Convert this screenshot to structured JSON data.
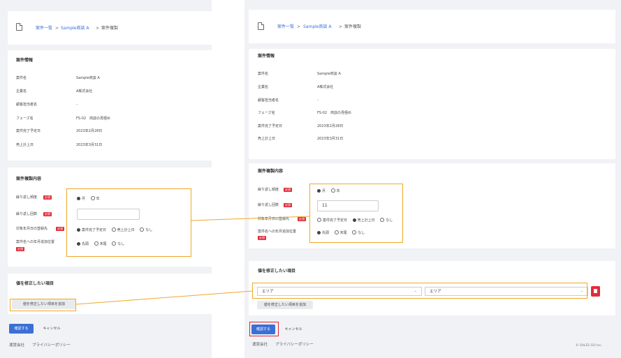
{
  "breadcrumb": {
    "list": "案件一覧",
    "sep1": ">",
    "item": "Sample商談 A",
    "sep2": ">",
    "current": "案件複製"
  },
  "info": {
    "title": "案件情報",
    "rows": [
      {
        "label": "案件名",
        "value": "Sample商談 A"
      },
      {
        "label": "企業名",
        "value": "A株式会社"
      },
      {
        "label": "顧客担当者名",
        "value": "-"
      },
      {
        "label": "フェーズ名",
        "value": "FS-02　商談の見極め"
      },
      {
        "label": "案件完了予定日",
        "value": "2023年2月28日"
      },
      {
        "label": "売上計上日",
        "value": "2023年3月31日"
      }
    ]
  },
  "dup": {
    "title": "案件複製内容",
    "required": "必須",
    "freq_label": "繰り返し頻度",
    "freq_opts": [
      "月",
      "年"
    ],
    "count_label": "繰り返し回数",
    "count_value_after": "11",
    "target_label": "対象年月日の登録先",
    "target_opts": [
      "案件完了予定日",
      "売上計上日",
      "なし"
    ],
    "pos_label": "案件名への年月追加位置",
    "pos_opts": [
      "先頭",
      "末尾",
      "なし"
    ]
  },
  "fix": {
    "title": "値を修正したい項目",
    "add_button": "値を修正したい項目を追加",
    "select_left": "エリア",
    "select_right": "エリア",
    "delete_icon": "trash-icon"
  },
  "actions": {
    "confirm": "確認する",
    "cancel": "キャンセル"
  },
  "footer": {
    "company": "運営会社",
    "privacy": "プライバシーポリシー",
    "copyright": "© SALES GO Inc."
  },
  "colors": {
    "accent": "#3b6fd6",
    "highlight": "#f0a72a",
    "emphasis": "#e0232f",
    "required": "#e02d3a"
  }
}
